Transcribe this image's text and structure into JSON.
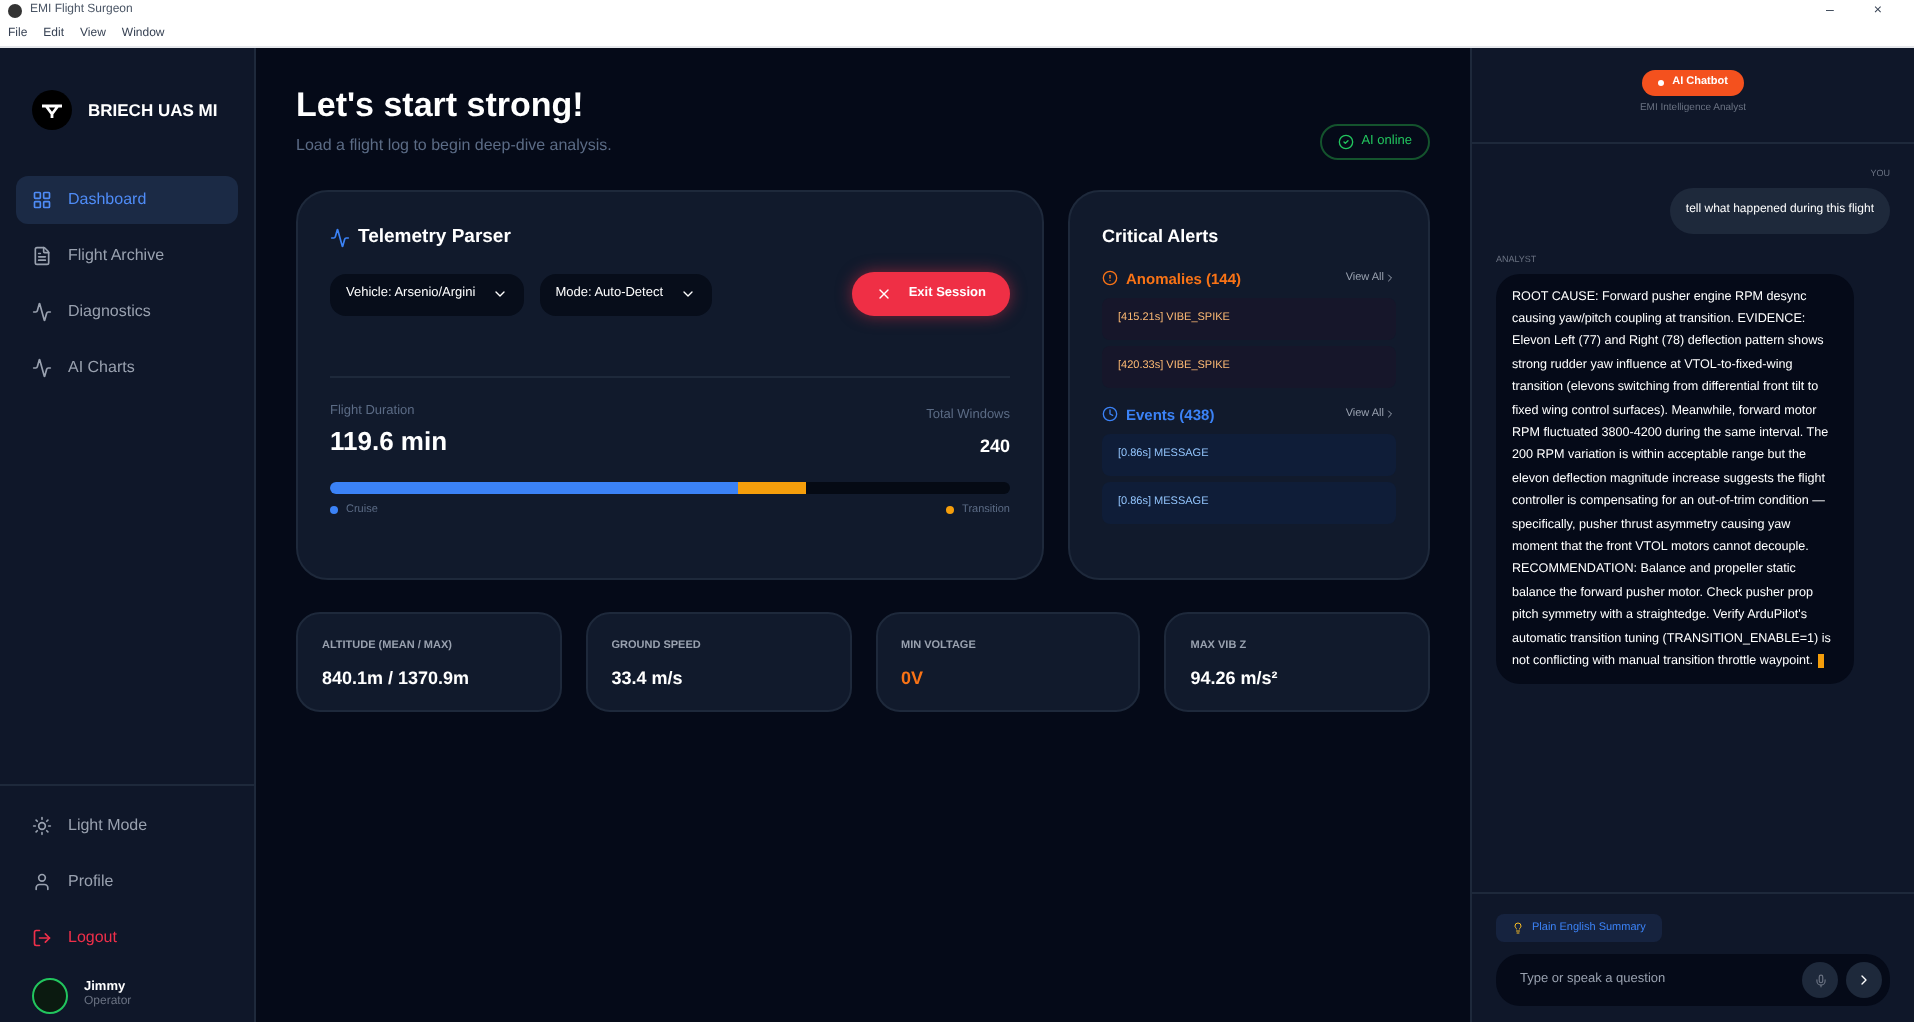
{
  "window": {
    "title": "EMI Flight Surgeon",
    "controls": [
      "–",
      "×"
    ]
  },
  "menu": [
    "File",
    "Edit",
    "View",
    "Window"
  ],
  "sidebar": {
    "brand": "BRIECH UAS MI",
    "items": [
      {
        "label": "Dashboard",
        "selected": true
      },
      {
        "label": "Flight Archive",
        "selected": false
      },
      {
        "label": "Diagnostics",
        "selected": false
      },
      {
        "label": "AI Charts",
        "selected": false
      }
    ],
    "bottom": [
      {
        "label": "Light Mode",
        "kind": "normal"
      },
      {
        "label": "Profile",
        "kind": "normal"
      },
      {
        "label": "Logout",
        "kind": "danger"
      }
    ],
    "user": {
      "name": "Jimmy",
      "role": "Operator"
    }
  },
  "header": {
    "title": "Let's start strong!",
    "subtitle": "Load a flight log to begin deep-dive analysis.",
    "status": "AI online"
  },
  "parser": {
    "title": "Telemetry Parser",
    "vehicle": "Vehicle: Arsenio/Argini",
    "mode": "Mode: Auto-Detect",
    "exit": "Exit Session",
    "duration_label": "Flight Duration",
    "duration": "119.6 min",
    "windows_label": "Total Windows",
    "windows": "240",
    "segments": [
      {
        "name": "Cruise",
        "color": "#3b82f6"
      },
      {
        "name": "Transition",
        "color": "#f59e0b"
      }
    ]
  },
  "alerts": {
    "title": "Critical Alerts",
    "groups": [
      {
        "kind": "anomaly",
        "title": "Anomalies (144)",
        "link": "View All",
        "items": [
          "[415.21s] VIBE_SPIKE",
          "[420.33s] VIBE_SPIKE"
        ]
      },
      {
        "kind": "event",
        "title": "Events (438)",
        "link": "View All",
        "items": [
          "[0.86s] MESSAGE",
          "[0.86s] MESSAGE"
        ]
      }
    ]
  },
  "stats": [
    {
      "label": "ALTITUDE (MEAN / MAX)",
      "value": "840.1m / 1370.9m",
      "kind": "normal"
    },
    {
      "label": "GROUND SPEED",
      "value": "33.4 m/s",
      "kind": "normal"
    },
    {
      "label": "MIN VOLTAGE",
      "value": "0V",
      "kind": "warning"
    },
    {
      "label": "MAX VIB Z",
      "value": "94.26 m/s²",
      "kind": "normal"
    }
  ],
  "chat": {
    "title": "AI Chatbot",
    "subtitle": "EMI Intelligence Analyst",
    "messages": [
      {
        "kind": "user",
        "author": "YOU",
        "text": "tell what happened during this flight"
      },
      {
        "kind": "analyst",
        "author": "ANALYST",
        "text": "ROOT CAUSE: Forward pusher engine RPM desync causing yaw/pitch coupling at transition. EVIDENCE: Elevon Left (77) and Right (78) deflection pattern shows strong rudder yaw influence at VTOL-to-fixed-wing transition (elevons switching from differential front tilt to fixed wing control surfaces). Meanwhile, forward motor RPM fluctuated 3800-4200 during the same interval. The 200 RPM variation is within acceptable range but the elevon deflection magnitude increase suggests the flight controller is compensating for an out-of-trim condition — specifically, pusher thrust asymmetry causing yaw moment that the front VTOL motors cannot decouple. RECOMMENDATION: Balance and propeller static balance the forward pusher motor. Check pusher prop pitch symmetry with a straightedge. Verify ArduPilot's automatic transition tuning (TRANSITION_ENABLE=1) is not conflicting with manual transition throttle waypoint."
      }
    ],
    "summary": "Plain English Summary",
    "placeholder": "Type or speak a question"
  }
}
